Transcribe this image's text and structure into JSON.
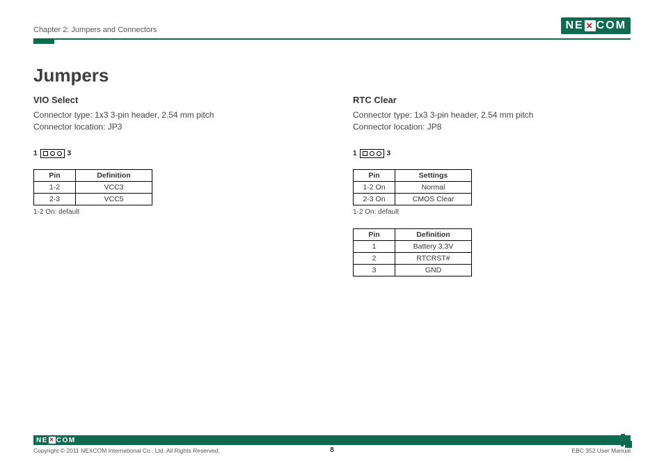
{
  "header": {
    "chapter": "Chapter 2: Jumpers and Connectors",
    "logo_left": "NE",
    "logo_x": "✕",
    "logo_right": "COM"
  },
  "title": "Jumpers",
  "left": {
    "heading": "VIO Select",
    "conn_type": "Connector type: 1x3 3-pin header, 2.54 mm pitch",
    "conn_loc": "Connector location: JP3",
    "pin_start": "1",
    "pin_end": "3",
    "table_h1": "Pin",
    "table_h2": "Definition",
    "r1c1": "1-2",
    "r1c2": "VCC3",
    "r2c1": "2-3",
    "r2c2": "VCC5",
    "note": "1-2 On: default"
  },
  "right": {
    "heading": "RTC Clear",
    "conn_type": "Connector type: 1x3 3-pin header, 2.54 mm pitch",
    "conn_loc": "Connector location: JP8",
    "pin_start": "1",
    "pin_end": "3",
    "t1_h1": "Pin",
    "t1_h2": "Settings",
    "t1_r1c1": "1-2 On",
    "t1_r1c2": "Normal",
    "t1_r2c1": "2-3 On",
    "t1_r2c2": "CMOS Clear",
    "note": "1-2 On: default",
    "t2_h1": "Pin",
    "t2_h2": "Definition",
    "t2_r1c1": "1",
    "t2_r1c2": "Battery 3.3V",
    "t2_r2c1": "2",
    "t2_r2c2": "RTCRST#",
    "t2_r3c1": "3",
    "t2_r3c2": "GND"
  },
  "footer": {
    "copyright": "Copyright © 2011 NEXCOM International Co., Ltd. All Rights Reserved.",
    "page": "8",
    "manual": "EBC 352 User Manual"
  }
}
